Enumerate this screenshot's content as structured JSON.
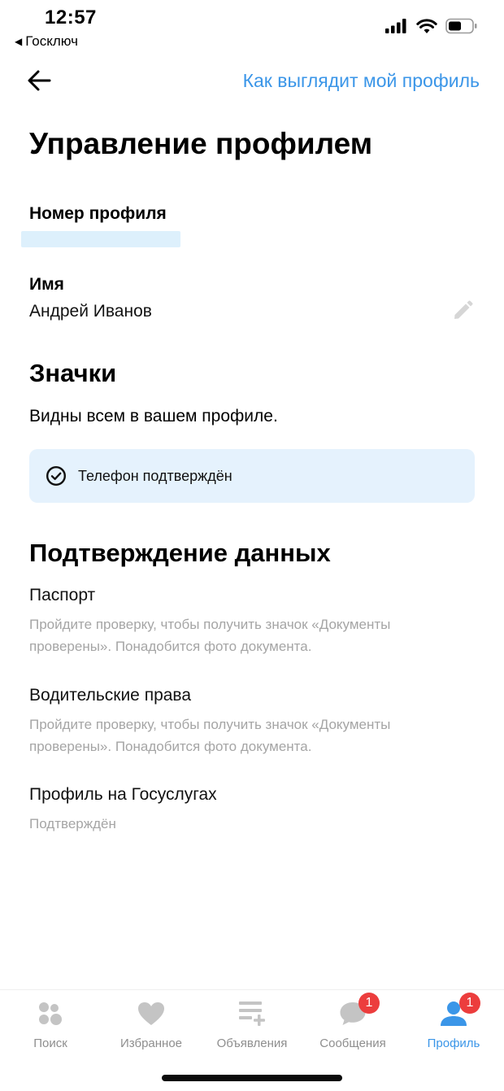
{
  "status_bar": {
    "time": "12:57",
    "back_app": "Госключ",
    "icons": [
      "signal-icon",
      "wifi-icon",
      "battery-icon"
    ]
  },
  "nav": {
    "back_icon": "arrow-left-icon",
    "appearance_link": "Как выглядит мой профиль"
  },
  "page_title": "Управление профилем",
  "profile": {
    "number_label": "Номер профиля",
    "name_label": "Имя",
    "name_value": "Андрей Иванов",
    "edit_icon": "pencil-icon"
  },
  "badges": {
    "title": "Значки",
    "description": "Видны всем в вашем профиле.",
    "items": [
      {
        "icon": "check-circle-icon",
        "label": "Телефон подтверждён"
      }
    ]
  },
  "verification": {
    "title": "Подтверждение данных",
    "items": [
      {
        "title": "Паспорт",
        "description": "Пройдите проверку, чтобы получить значок «Документы проверены». Понадобится фото документа."
      },
      {
        "title": "Водительские права",
        "description": "Пройдите проверку, чтобы получить значок «Документы проверены». Понадобится фото документа."
      },
      {
        "title": "Профиль на Госуслугах",
        "description": "Подтверждён"
      }
    ]
  },
  "tabbar": {
    "tabs": [
      {
        "label": "Поиск",
        "icon": "search-dots-icon",
        "active": false
      },
      {
        "label": "Избранное",
        "icon": "heart-icon",
        "active": false
      },
      {
        "label": "Объявления",
        "icon": "list-add-icon",
        "active": false
      },
      {
        "label": "Сообщения",
        "icon": "chat-bubble-icon",
        "active": false,
        "badge": "1"
      },
      {
        "label": "Профиль",
        "icon": "person-icon",
        "active": true,
        "badge": "1"
      }
    ]
  },
  "colors": {
    "accent": "#3b96e8",
    "badge_card_bg": "#e5f2fd",
    "notification_badge": "#ec3d3d",
    "muted_text": "#a5a5a5",
    "inactive_icon": "#c4c4c4"
  }
}
